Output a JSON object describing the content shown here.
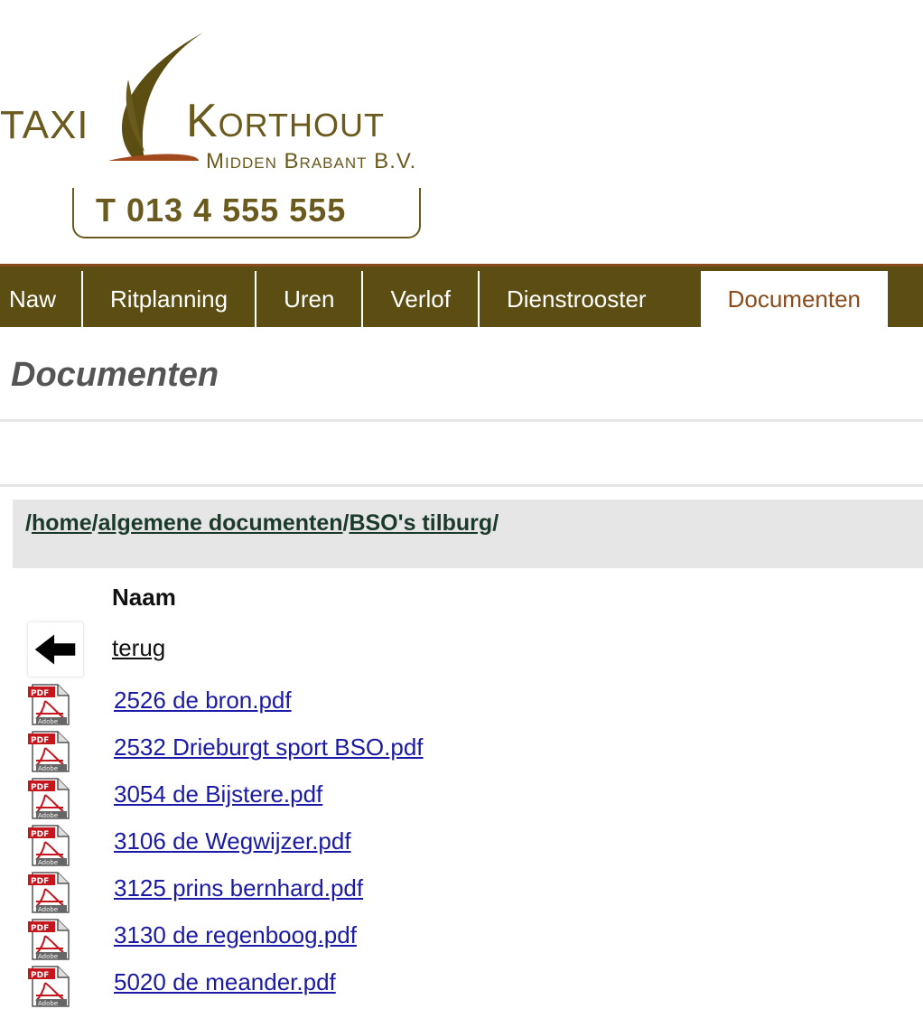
{
  "logo": {
    "taxi": "TAXI",
    "name": "Korthout",
    "subtitle": "Midden Brabant B.V.",
    "phone": "T 013 4 555 555"
  },
  "nav": {
    "items": [
      {
        "label": "Naw"
      },
      {
        "label": "Ritplanning"
      },
      {
        "label": "Uren"
      },
      {
        "label": "Verlof"
      },
      {
        "label": "Dienstrooster"
      },
      {
        "label": "Documenten"
      }
    ],
    "active": "Documenten"
  },
  "page": {
    "title": "Documenten"
  },
  "breadcrumb": {
    "parts": [
      "home",
      "algemene documenten",
      "BSO's tilburg"
    ]
  },
  "table": {
    "header": "Naam",
    "back_label": "terug",
    "files": [
      "2526 de bron.pdf",
      "2532 Drieburgt sport BSO.pdf",
      "3054 de Bijstere.pdf",
      "3106 de Wegwijzer.pdf",
      "3125 prins bernhard.pdf",
      "3130 de regenboog.pdf",
      "5020 de meander.pdf"
    ]
  },
  "colors": {
    "nav_bg": "#5c4d12",
    "accent": "#8a4a1c",
    "link": "#1a1aa6",
    "breadcrumb_text": "#1b3a2b"
  },
  "icons": {
    "back": "arrow-left-icon",
    "file": "pdf-icon"
  }
}
